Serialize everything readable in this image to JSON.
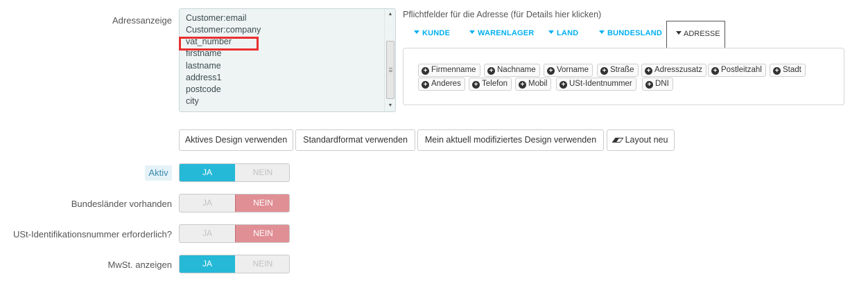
{
  "address_display": {
    "label": "Adressanzeige",
    "lines": [
      "Customer:email",
      "Customer:company",
      "vat_number",
      "firstname",
      "lastname",
      "address1",
      "postcode",
      "city"
    ]
  },
  "required_fields": {
    "link_text": "Pflichtfelder für die Adresse (für Details hier klicken)",
    "tabs": [
      "KUNDE",
      "WARENLAGER",
      "LAND",
      "BUNDESLAND",
      "ADRESSE"
    ],
    "active_tab": "ADRESSE",
    "chips": [
      "Firmenname",
      "Nachname",
      "Vorname",
      "Straße",
      "Adresszusatz",
      "Postleitzahl",
      "Stadt",
      "Anderes",
      "Telefon",
      "Mobil",
      "USt-Identnummer",
      "DNI"
    ]
  },
  "format_buttons": {
    "active_design": "Aktives Design verwenden",
    "standard_format": "Standardformat verwenden",
    "my_modified_design": "Mein aktuell modifiziertes Design verwenden",
    "layout_new": "Layout neu"
  },
  "toggles": [
    {
      "label": "Aktiv",
      "yes": "JA",
      "no": "NEIN",
      "value": "yes"
    },
    {
      "label": "Bundesländer vorhanden",
      "yes": "JA",
      "no": "NEIN",
      "value": "no"
    },
    {
      "label": "USt-Identifikationsnummer erforderlich?",
      "yes": "JA",
      "no": "NEIN",
      "value": "no"
    },
    {
      "label": "MwSt. anzeigen",
      "yes": "JA",
      "no": "NEIN",
      "value": "yes"
    }
  ],
  "colors": {
    "accent": "#25b9d7",
    "no_active": "#e08f95",
    "tab_link": "#00aff0",
    "highlight_box": "#e8302f"
  }
}
